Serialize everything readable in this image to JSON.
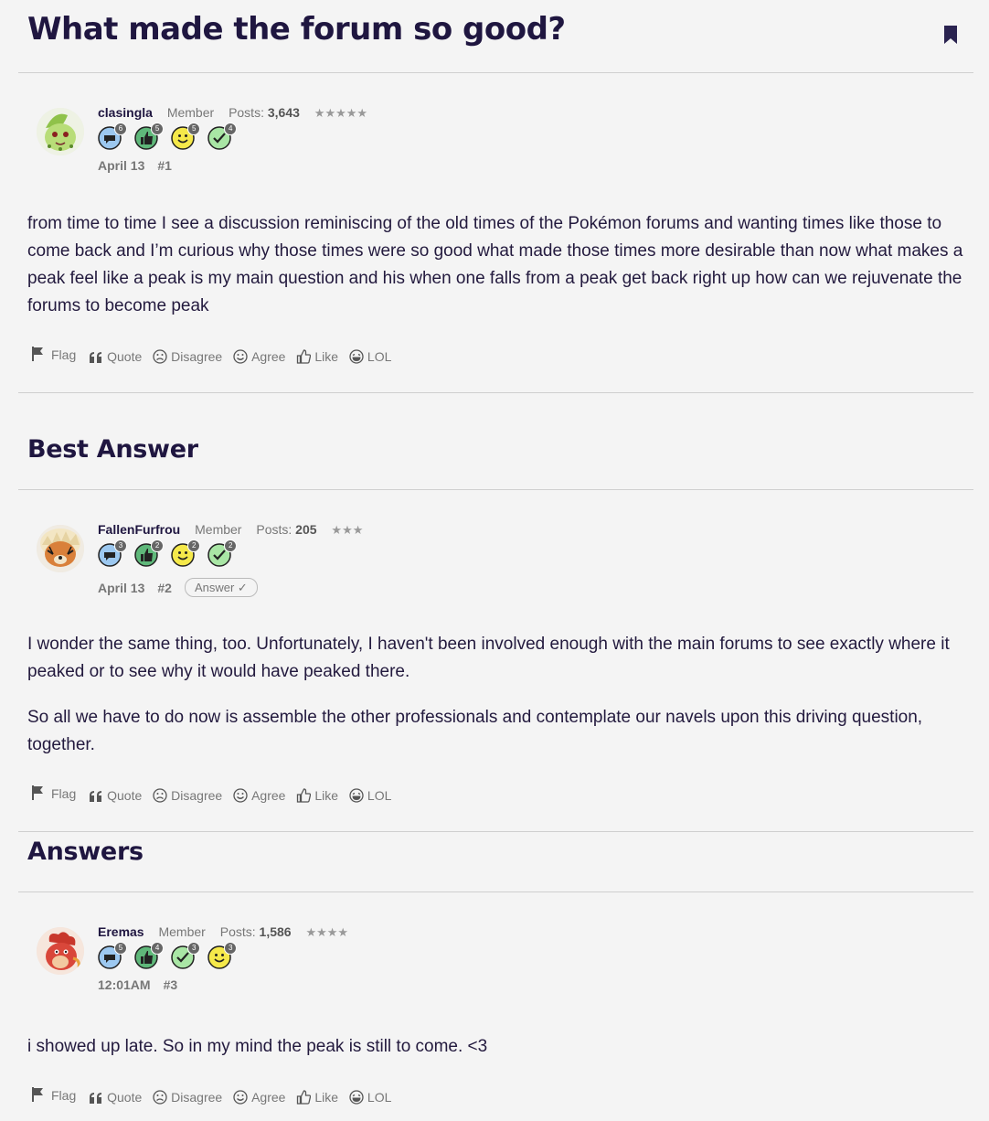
{
  "thread": {
    "title": "What made the forum so good?"
  },
  "sections": {
    "best_answer": "Best Answer",
    "answers": "Answers"
  },
  "actions": {
    "flag": "Flag",
    "quote": "Quote",
    "disagree": "Disagree",
    "agree": "Agree",
    "like": "Like",
    "lol": "LOL"
  },
  "posts": [
    {
      "username": "clasingla",
      "role": "Member",
      "posts_label": "Posts:",
      "posts_count": "3,643",
      "stars": "★★★★★",
      "badges": [
        {
          "icon": "comment-badge-icon",
          "count": "6"
        },
        {
          "icon": "thumbs-up-badge-icon",
          "count": "5"
        },
        {
          "icon": "smile-badge-icon",
          "count": "5"
        },
        {
          "icon": "check-badge-icon",
          "count": "4"
        }
      ],
      "date": "April 13",
      "number": "#1",
      "paragraphs": [
        "from time to time I see a discussion reminiscing of the old times of the Pokémon forums and wanting times like those to come back and I’m curious why those times were so good what made those times more desirable than now what makes a peak feel like a peak is my main question and his when one falls from a peak get back right up how can we rejuvenate the forums to become peak"
      ]
    },
    {
      "username": "FallenFurfrou",
      "role": "Member",
      "posts_label": "Posts:",
      "posts_count": "205",
      "stars": "★★★",
      "badges": [
        {
          "icon": "comment-badge-icon",
          "count": "3"
        },
        {
          "icon": "thumbs-up-badge-icon",
          "count": "2"
        },
        {
          "icon": "smile-badge-icon",
          "count": "2"
        },
        {
          "icon": "check-badge-icon",
          "count": "2"
        }
      ],
      "date": "April 13",
      "number": "#2",
      "answer_tag": "Answer ✓",
      "paragraphs": [
        "I wonder the same thing, too. Unfortunately, I haven't been involved enough with the main forums to see exactly where it peaked or to see why it would have peaked there.",
        "So all we have to do now is assemble the other professionals and contemplate our navels upon this driving question, together."
      ]
    },
    {
      "username": "Eremas",
      "role": "Member",
      "posts_label": "Posts:",
      "posts_count": "1,586",
      "stars": "★★★★",
      "badges": [
        {
          "icon": "comment-badge-icon",
          "count": "5"
        },
        {
          "icon": "thumbs-up-badge-icon",
          "count": "4"
        },
        {
          "icon": "check-badge-icon",
          "count": "3"
        },
        {
          "icon": "smile-badge-icon",
          "count": "3"
        }
      ],
      "date": "12:01AM",
      "number": "#3",
      "paragraphs": [
        "i showed up late. So in my mind the peak is still to come. <3"
      ]
    }
  ]
}
